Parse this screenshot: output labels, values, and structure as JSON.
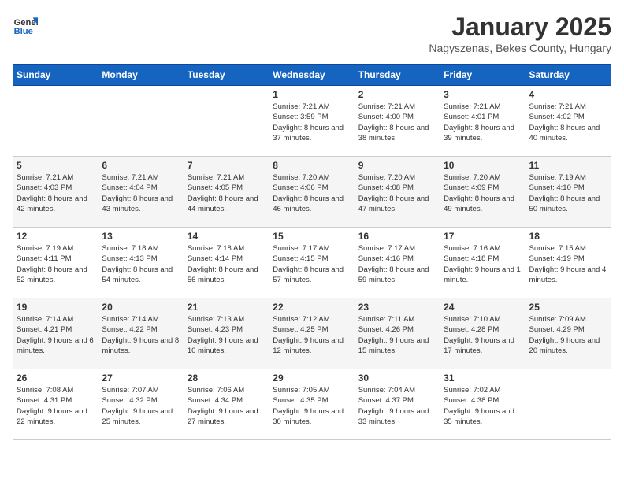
{
  "header": {
    "logo_general": "General",
    "logo_blue": "Blue",
    "title": "January 2025",
    "subtitle": "Nagyszenas, Bekes County, Hungary"
  },
  "weekdays": [
    "Sunday",
    "Monday",
    "Tuesday",
    "Wednesday",
    "Thursday",
    "Friday",
    "Saturday"
  ],
  "weeks": [
    [
      {
        "day": "",
        "info": ""
      },
      {
        "day": "",
        "info": ""
      },
      {
        "day": "",
        "info": ""
      },
      {
        "day": "1",
        "info": "Sunrise: 7:21 AM\nSunset: 3:59 PM\nDaylight: 8 hours and 37 minutes."
      },
      {
        "day": "2",
        "info": "Sunrise: 7:21 AM\nSunset: 4:00 PM\nDaylight: 8 hours and 38 minutes."
      },
      {
        "day": "3",
        "info": "Sunrise: 7:21 AM\nSunset: 4:01 PM\nDaylight: 8 hours and 39 minutes."
      },
      {
        "day": "4",
        "info": "Sunrise: 7:21 AM\nSunset: 4:02 PM\nDaylight: 8 hours and 40 minutes."
      }
    ],
    [
      {
        "day": "5",
        "info": "Sunrise: 7:21 AM\nSunset: 4:03 PM\nDaylight: 8 hours and 42 minutes."
      },
      {
        "day": "6",
        "info": "Sunrise: 7:21 AM\nSunset: 4:04 PM\nDaylight: 8 hours and 43 minutes."
      },
      {
        "day": "7",
        "info": "Sunrise: 7:21 AM\nSunset: 4:05 PM\nDaylight: 8 hours and 44 minutes."
      },
      {
        "day": "8",
        "info": "Sunrise: 7:20 AM\nSunset: 4:06 PM\nDaylight: 8 hours and 46 minutes."
      },
      {
        "day": "9",
        "info": "Sunrise: 7:20 AM\nSunset: 4:08 PM\nDaylight: 8 hours and 47 minutes."
      },
      {
        "day": "10",
        "info": "Sunrise: 7:20 AM\nSunset: 4:09 PM\nDaylight: 8 hours and 49 minutes."
      },
      {
        "day": "11",
        "info": "Sunrise: 7:19 AM\nSunset: 4:10 PM\nDaylight: 8 hours and 50 minutes."
      }
    ],
    [
      {
        "day": "12",
        "info": "Sunrise: 7:19 AM\nSunset: 4:11 PM\nDaylight: 8 hours and 52 minutes."
      },
      {
        "day": "13",
        "info": "Sunrise: 7:18 AM\nSunset: 4:13 PM\nDaylight: 8 hours and 54 minutes."
      },
      {
        "day": "14",
        "info": "Sunrise: 7:18 AM\nSunset: 4:14 PM\nDaylight: 8 hours and 56 minutes."
      },
      {
        "day": "15",
        "info": "Sunrise: 7:17 AM\nSunset: 4:15 PM\nDaylight: 8 hours and 57 minutes."
      },
      {
        "day": "16",
        "info": "Sunrise: 7:17 AM\nSunset: 4:16 PM\nDaylight: 8 hours and 59 minutes."
      },
      {
        "day": "17",
        "info": "Sunrise: 7:16 AM\nSunset: 4:18 PM\nDaylight: 9 hours and 1 minute."
      },
      {
        "day": "18",
        "info": "Sunrise: 7:15 AM\nSunset: 4:19 PM\nDaylight: 9 hours and 4 minutes."
      }
    ],
    [
      {
        "day": "19",
        "info": "Sunrise: 7:14 AM\nSunset: 4:21 PM\nDaylight: 9 hours and 6 minutes."
      },
      {
        "day": "20",
        "info": "Sunrise: 7:14 AM\nSunset: 4:22 PM\nDaylight: 9 hours and 8 minutes."
      },
      {
        "day": "21",
        "info": "Sunrise: 7:13 AM\nSunset: 4:23 PM\nDaylight: 9 hours and 10 minutes."
      },
      {
        "day": "22",
        "info": "Sunrise: 7:12 AM\nSunset: 4:25 PM\nDaylight: 9 hours and 12 minutes."
      },
      {
        "day": "23",
        "info": "Sunrise: 7:11 AM\nSunset: 4:26 PM\nDaylight: 9 hours and 15 minutes."
      },
      {
        "day": "24",
        "info": "Sunrise: 7:10 AM\nSunset: 4:28 PM\nDaylight: 9 hours and 17 minutes."
      },
      {
        "day": "25",
        "info": "Sunrise: 7:09 AM\nSunset: 4:29 PM\nDaylight: 9 hours and 20 minutes."
      }
    ],
    [
      {
        "day": "26",
        "info": "Sunrise: 7:08 AM\nSunset: 4:31 PM\nDaylight: 9 hours and 22 minutes."
      },
      {
        "day": "27",
        "info": "Sunrise: 7:07 AM\nSunset: 4:32 PM\nDaylight: 9 hours and 25 minutes."
      },
      {
        "day": "28",
        "info": "Sunrise: 7:06 AM\nSunset: 4:34 PM\nDaylight: 9 hours and 27 minutes."
      },
      {
        "day": "29",
        "info": "Sunrise: 7:05 AM\nSunset: 4:35 PM\nDaylight: 9 hours and 30 minutes."
      },
      {
        "day": "30",
        "info": "Sunrise: 7:04 AM\nSunset: 4:37 PM\nDaylight: 9 hours and 33 minutes."
      },
      {
        "day": "31",
        "info": "Sunrise: 7:02 AM\nSunset: 4:38 PM\nDaylight: 9 hours and 35 minutes."
      },
      {
        "day": "",
        "info": ""
      }
    ]
  ]
}
